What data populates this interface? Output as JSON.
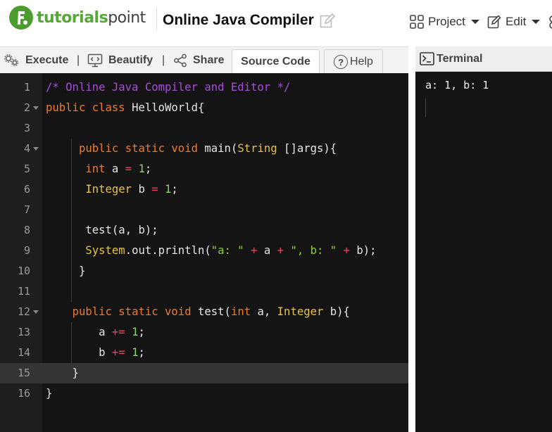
{
  "header": {
    "logo_text_a": "tutorials",
    "logo_text_b": "point",
    "page_title": "Online Java Compiler",
    "nav": [
      {
        "label": "Project",
        "icon": "grid-icon"
      },
      {
        "label": "Edit",
        "icon": "edit-icon"
      }
    ]
  },
  "toolbar": {
    "execute": "Execute",
    "beautify": "Beautify",
    "share": "Share",
    "separator": "|",
    "tabs": [
      {
        "label": "Source Code",
        "active": true
      },
      {
        "label": "Help",
        "icon": "help-circle-icon",
        "icon_glyph": "?"
      }
    ]
  },
  "editor": {
    "active_line": 15,
    "lines": [
      {
        "n": "1",
        "text": "/* Online Java Compiler and Editor */"
      },
      {
        "n": "2",
        "text": "public class HelloWorld{"
      },
      {
        "n": "3",
        "text": ""
      },
      {
        "n": "4",
        "text": "     public static void main(String []args){"
      },
      {
        "n": "5",
        "text": "      int a = 1;"
      },
      {
        "n": "6",
        "text": "      Integer b = 1;"
      },
      {
        "n": "7",
        "text": ""
      },
      {
        "n": "8",
        "text": "      test(a, b);"
      },
      {
        "n": "9",
        "text": "      System.out.println(\"a: \" + a + \", b: \" + b);"
      },
      {
        "n": "10",
        "text": "     }"
      },
      {
        "n": "11",
        "text": ""
      },
      {
        "n": "12",
        "text": "    public static void test(int a, Integer b){"
      },
      {
        "n": "13",
        "text": "        a += 1;"
      },
      {
        "n": "14",
        "text": "        b += 1;"
      },
      {
        "n": "15",
        "text": "    }"
      },
      {
        "n": "16",
        "text": "}"
      }
    ]
  },
  "terminal": {
    "title": "Terminal",
    "output": "a: 1, b: 1"
  },
  "colors": {
    "brand_green": "#4c9c2e",
    "editor_bg": "#141414",
    "keyword": "#ef7a2c",
    "type": "#e9a93c",
    "comment": "#a64fd6",
    "number": "#8fd16d",
    "string": "#8ccf3f",
    "operator": "#e8465f"
  }
}
